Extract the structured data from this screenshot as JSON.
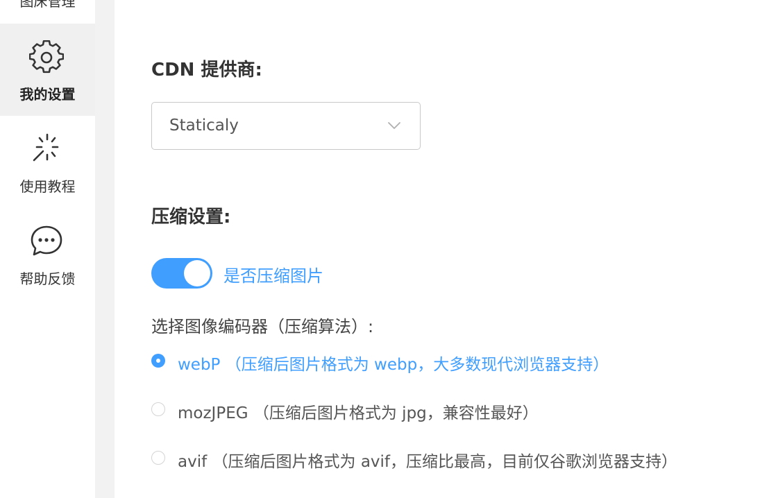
{
  "sidebar": {
    "items": [
      {
        "label": "图床管理",
        "icon": "image-bed-icon",
        "active": false
      },
      {
        "label": "我的设置",
        "icon": "gear-icon",
        "active": true
      },
      {
        "label": "使用教程",
        "icon": "magic-wand-icon",
        "active": false
      },
      {
        "label": "帮助反馈",
        "icon": "chat-bubble-icon",
        "active": false
      }
    ]
  },
  "settings": {
    "cdn_label": "CDN 提供商:",
    "cdn_selected": "Staticaly",
    "compress_title": "压缩设置:",
    "compress_toggle_label": "是否压缩图片",
    "compress_enabled": true,
    "encoder_label": "选择图像编码器（压缩算法）:",
    "encoders": [
      {
        "label": "webP （压缩后图片格式为 webp，大多数现代浏览器支持）",
        "checked": true
      },
      {
        "label": "mozJPEG （压缩后图片格式为 jpg，兼容性最好）",
        "checked": false
      },
      {
        "label": "avif （压缩后图片格式为 avif，压缩比最高，目前仅谷歌浏览器支持）",
        "checked": false
      }
    ]
  },
  "colors": {
    "accent": "#409eff",
    "sidebar_active_bg": "#f0f0f0",
    "gutter_bg": "#f2f2f2"
  }
}
